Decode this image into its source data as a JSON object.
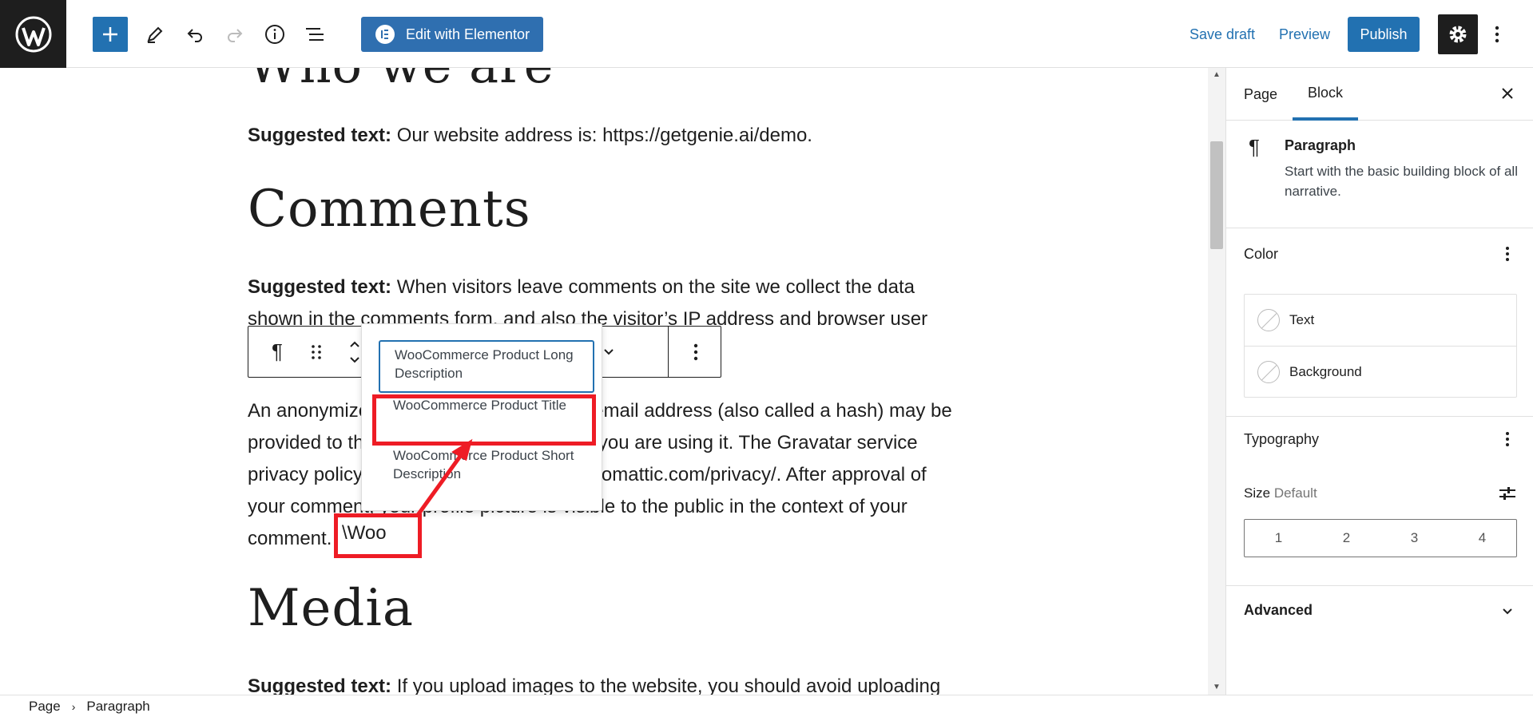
{
  "toolbar": {
    "elementor_label": "Edit with Elementor",
    "save_draft_label": "Save draft",
    "preview_label": "Preview",
    "publish_label": "Publish"
  },
  "content": {
    "heading_who": "Who we are",
    "p1_bold": "Suggested text:",
    "p1_text": " Our website address is: https://getgenie.ai/demo.",
    "heading_comments": "Comments",
    "p2_bold": "Suggested text:",
    "p2_text": " When visitors leave comments on the site we collect the data shown in the comments form, and also the visitor’s IP address and browser user",
    "p3_text": "An anonymized string created from your email address (also called a hash) may be provided to the Gravatar service to see if you are using it. The Gravatar service privacy policy is available here: https://automattic.com/privacy/. After approval of your comment, your profile picture is visible to the public in the context of your comment. ",
    "typed_text": "\\Woo",
    "heading_media": "Media",
    "p4_bold": "Suggested text:",
    "p4_text": " If you upload images to the website, you should avoid uploading"
  },
  "autocomplete": {
    "options": [
      "WooCommerce Product Long Description",
      "WooCommerce Product Title",
      "WooCommerce Product Short Description"
    ]
  },
  "sidebar": {
    "tabs": [
      "Page",
      "Block"
    ],
    "block_title": "Paragraph",
    "block_description": "Start with the basic building block of all narrative.",
    "color_title": "Color",
    "color_items": [
      "Text",
      "Background"
    ],
    "typography_title": "Typography",
    "size_label": "Size",
    "size_value": "Default",
    "size_options": [
      "1",
      "2",
      "3",
      "4"
    ],
    "advanced_title": "Advanced"
  },
  "footer": {
    "breadcrumb": [
      "Page",
      "Paragraph"
    ]
  },
  "colors": {
    "accent": "#2271b1",
    "elementor": "#2f6fb0",
    "annotation_red": "#ee1c25",
    "dark": "#1e1e1e"
  }
}
